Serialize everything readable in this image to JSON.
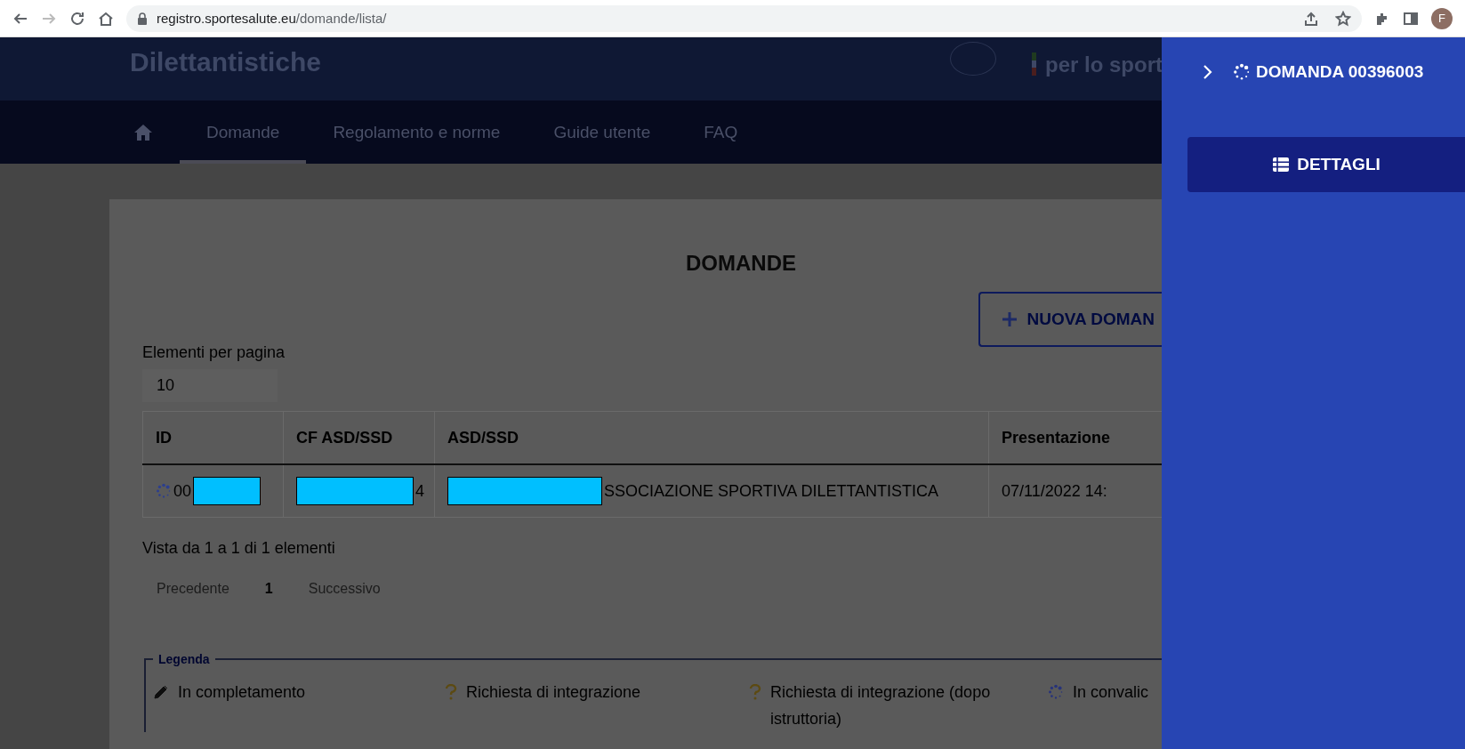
{
  "browser": {
    "url_host": "registro.sportesalute.eu",
    "url_path": "/domande/lista/",
    "avatar_letter": "F"
  },
  "header": {
    "title": "Dilettantistiche",
    "logo_text": "per lo sport"
  },
  "nav": {
    "items": [
      {
        "label": "Domande",
        "selected": true
      },
      {
        "label": "Regolamento e norme",
        "selected": false
      },
      {
        "label": "Guide utente",
        "selected": false
      },
      {
        "label": "FAQ",
        "selected": false
      }
    ]
  },
  "content": {
    "title": "DOMANDE",
    "new_button": "NUOVA DOMAN",
    "per_page_label": "Elementi per pagina",
    "per_page_value": "10",
    "table": {
      "columns": [
        "ID",
        "CF ASD/SSD",
        "ASD/SSD",
        "Presentazione"
      ],
      "rows": [
        {
          "cells": [
            {
              "parts": [
                {
                  "kind": "status"
                },
                {
                  "kind": "text",
                  "text": "00"
                },
                {
                  "kind": "redaction"
                }
              ]
            },
            {
              "parts": [
                {
                  "kind": "redaction"
                },
                {
                  "kind": "text",
                  "text": "4"
                }
              ]
            },
            {
              "parts": [
                {
                  "kind": "redaction"
                },
                {
                  "kind": "text",
                  "text": "SSOCIAZIONE SPORTIVA DILETTANTISTICA"
                }
              ]
            },
            {
              "parts": [
                {
                  "kind": "text",
                  "text": "07/11/2022 14:"
                }
              ]
            }
          ]
        }
      ]
    },
    "info": "Vista da 1 a 1 di 1 elementi",
    "pagination": [
      {
        "label": "Precedente",
        "disabled": true
      },
      {
        "label": "1",
        "disabled": false
      },
      {
        "label": "Successivo",
        "disabled": true
      }
    ],
    "legend": {
      "title": "Legenda",
      "items": [
        {
          "kind": "pencil",
          "label": "In completamento"
        },
        {
          "kind": "question",
          "label": "Richiesta di integrazione"
        },
        {
          "kind": "question",
          "label": "Richiesta di integrazione (dopo istruttoria)"
        },
        {
          "kind": "spinner",
          "label": "In convalic"
        }
      ]
    }
  },
  "panel": {
    "title": "DOMANDA 00396003",
    "button": "DETTAGLI"
  }
}
